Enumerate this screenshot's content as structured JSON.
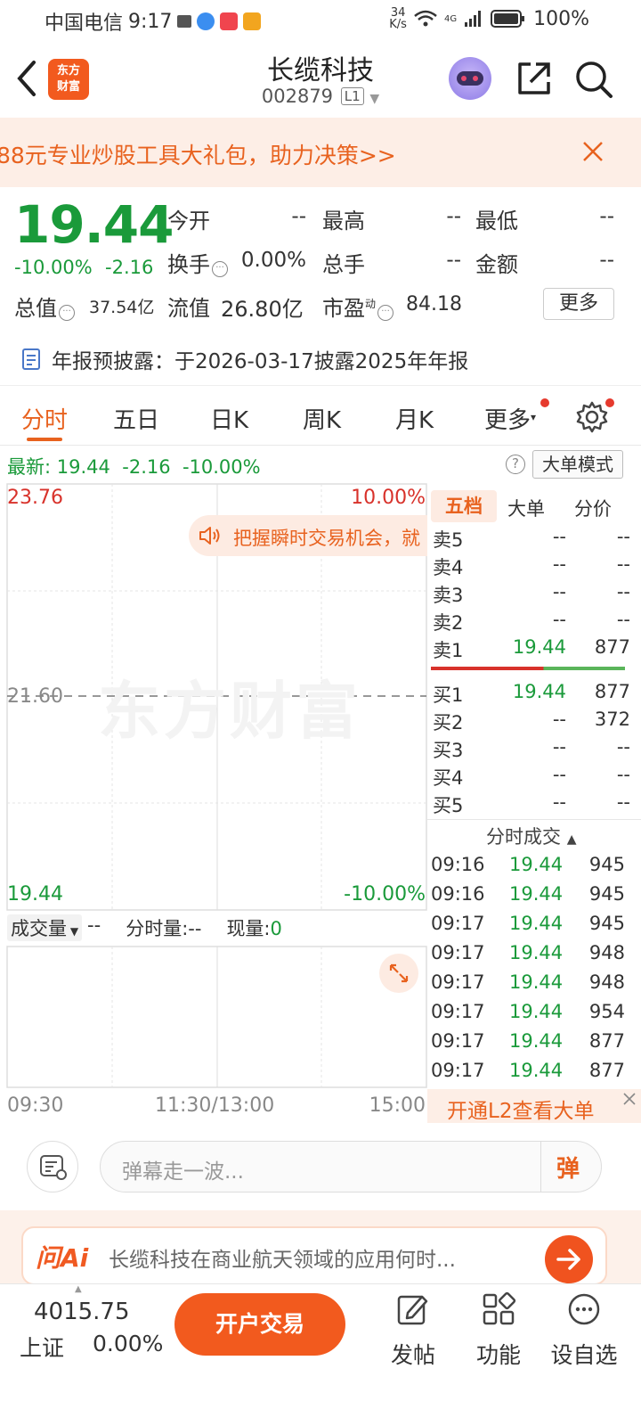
{
  "status_bar": {
    "carrier": "中国电信",
    "time": "9:17",
    "net_speed_top": "34",
    "net_speed_bottom": "K/s",
    "network": "4G",
    "battery": "100%"
  },
  "header": {
    "logo_line1": "东方",
    "logo_line2": "财富",
    "stock_name": "长缆科技",
    "stock_code": "002879",
    "level_badge": "L1"
  },
  "promo": {
    "text": "88元专业炒股工具大礼包，助力决策>>"
  },
  "quote": {
    "price": "19.44",
    "change_pct": "-10.00%",
    "change": "-2.16",
    "fields": [
      {
        "label": "今开",
        "value": "--"
      },
      {
        "label": "最高",
        "value": "--"
      },
      {
        "label": "最低",
        "value": "--"
      },
      {
        "label": "换手",
        "value": "0.00%"
      },
      {
        "label": "总手",
        "value": "--"
      },
      {
        "label": "金额",
        "value": "--"
      }
    ],
    "total_value_label": "总值",
    "total_value": "37.54亿",
    "float_value_label": "流值",
    "float_value": "26.80亿",
    "pe_label": "市盈",
    "pe_superscript": "动",
    "pe_value": "84.18",
    "more_label": "更多",
    "disclosure": "年报预披露：于2026-03-17披露2025年年报"
  },
  "tabs": [
    "分时",
    "五日",
    "日K",
    "周K",
    "月K",
    "更多"
  ],
  "latest": {
    "label": "最新:",
    "price": "19.44",
    "change": "-2.16",
    "pct": "-10.00%",
    "help": "?",
    "big_order_mode": "大单模式"
  },
  "chart": {
    "top_price": "23.76",
    "top_pct": "10.00%",
    "mid_price": "21.60",
    "bottom_price": "19.44",
    "bottom_pct": "-10.00%",
    "tooltip": "把握瞬时交易机会，就",
    "watermark": "东方财富",
    "volume_label": "成交量",
    "volume_value": "--",
    "minute_vol_label": "分时量:",
    "minute_vol_value": "--",
    "current_vol_label": "现量:",
    "current_vol_value": "0",
    "time_start": "09:30",
    "time_mid": "11:30/13:00",
    "time_end": "15:00"
  },
  "orderbook": {
    "tabs": [
      "五档",
      "大单",
      "分价"
    ],
    "sells": [
      {
        "label": "卖5",
        "price": "--",
        "vol": "--"
      },
      {
        "label": "卖4",
        "price": "--",
        "vol": "--"
      },
      {
        "label": "卖3",
        "price": "--",
        "vol": "--"
      },
      {
        "label": "卖2",
        "price": "--",
        "vol": "--"
      },
      {
        "label": "卖1",
        "price": "19.44",
        "vol": "877"
      }
    ],
    "buys": [
      {
        "label": "买1",
        "price": "19.44",
        "vol": "877"
      },
      {
        "label": "买2",
        "price": "--",
        "vol": "372"
      },
      {
        "label": "买3",
        "price": "--",
        "vol": "--"
      },
      {
        "label": "买4",
        "price": "--",
        "vol": "--"
      },
      {
        "label": "买5",
        "price": "--",
        "vol": "--"
      }
    ],
    "trades_header": "分时成交",
    "trades": [
      {
        "time": "09:16",
        "price": "19.44",
        "vol": "945"
      },
      {
        "time": "09:16",
        "price": "19.44",
        "vol": "945"
      },
      {
        "time": "09:17",
        "price": "19.44",
        "vol": "945"
      },
      {
        "time": "09:17",
        "price": "19.44",
        "vol": "948"
      },
      {
        "time": "09:17",
        "price": "19.44",
        "vol": "948"
      },
      {
        "time": "09:17",
        "price": "19.44",
        "vol": "954"
      },
      {
        "time": "09:17",
        "price": "19.44",
        "vol": "877"
      },
      {
        "time": "09:17",
        "price": "19.44",
        "vol": "877"
      }
    ],
    "l2_promo": "开通L2查看大单"
  },
  "comment": {
    "placeholder": "弹幕走一波...",
    "danmu_btn": "弹"
  },
  "ai": {
    "logo": "问Ai",
    "question": "长缆科技在商业航天领域的应用何时..."
  },
  "bottom_nav": {
    "index_value": "4015.75",
    "index_name": "上证",
    "index_pct": "0.00%",
    "trade_btn": "开户交易",
    "post": "发帖",
    "functions": "功能",
    "watchlist": "设自选"
  },
  "colors": {
    "down_green": "#1a9a3a",
    "up_red": "#d8322b",
    "accent_orange": "#e8621f"
  }
}
